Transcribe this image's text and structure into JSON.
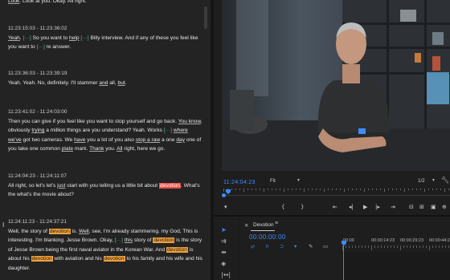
{
  "transcript": {
    "partial_top": [
      {
        "t": "Look",
        "u": true
      },
      {
        "t": ". Look at you. Okay. All right."
      }
    ],
    "paragraphs": [
      {
        "timestamp": "11:23:15:03 - 11:23:36:02",
        "segments": [
          {
            "t": "Yeah",
            "u": true
          },
          {
            "t": ". "
          },
          {
            "t": "[···]",
            "g": true
          },
          {
            "t": " So you want to "
          },
          {
            "t": "help",
            "u": true
          },
          {
            "t": " "
          },
          {
            "t": "[···]",
            "g": true
          },
          {
            "t": " Billy interview. And if any of these you feel like you want to "
          },
          {
            "t": "[···]",
            "g": true
          },
          {
            "t": " re answer."
          }
        ]
      },
      {
        "timestamp": "11:23:36:03 - 11:23:39:19",
        "segments": [
          {
            "t": "Yeah. Yeah. No, definitely. I'll stammer "
          },
          {
            "t": "and",
            "u": true
          },
          {
            "t": " all, "
          },
          {
            "t": "but",
            "u": true
          },
          {
            "t": "."
          }
        ]
      },
      {
        "timestamp": "11:23:41:02 - 11:24:03:00",
        "segments": [
          {
            "t": "Then you can give if you feel like you want to stop yourself and go back. "
          },
          {
            "t": "You know",
            "u": true
          },
          {
            "t": ", obviously "
          },
          {
            "t": "trying",
            "u": true
          },
          {
            "t": " a million things are you understand? Yeah. Works "
          },
          {
            "t": "[···]",
            "g": true
          },
          {
            "t": " "
          },
          {
            "t": "where we've",
            "u": true
          },
          {
            "t": " got two cameras. We "
          },
          {
            "t": "have",
            "u": true
          },
          {
            "t": " you a lot of you also "
          },
          {
            "t": "stop a raw",
            "u": true
          },
          {
            "t": " a one "
          },
          {
            "t": "day",
            "u": true
          },
          {
            "t": " one of you take one common "
          },
          {
            "t": "plate",
            "u": true
          },
          {
            "t": " mark. "
          },
          {
            "t": "Thank",
            "u": true
          },
          {
            "t": " you. "
          },
          {
            "t": "All",
            "u": true
          },
          {
            "t": " right, here we go."
          }
        ]
      },
      {
        "timestamp": "11:24:04:23 - 11:24:11:07",
        "segments": [
          {
            "t": "All right, so let's let's "
          },
          {
            "t": "just",
            "u": true
          },
          {
            "t": " start with you telling us a little bit about "
          },
          {
            "t": "devotion",
            "hs": true
          },
          {
            "t": ". What's the what's the movie about?"
          }
        ]
      },
      {
        "timestamp": "11:24:11:23 - 11:24:37:21",
        "segments": [
          {
            "t": "Well, the story of "
          },
          {
            "t": "devotion",
            "h": true
          },
          {
            "t": " is. "
          },
          {
            "t": "Well",
            "u": true
          },
          {
            "t": ", see, I'm already stammering. my God, This is interesting. I'm blanking. Jesse Brown. Okay, "
          },
          {
            "t": "[···]",
            "g": true
          },
          {
            "t": " "
          },
          {
            "t": "this",
            "u": true
          },
          {
            "t": " story of "
          },
          {
            "t": "devotion",
            "h": true
          },
          {
            "t": " is the story of Jesse Brown being the first naval aviator in the Korean War. And "
          },
          {
            "t": "devotion",
            "h": true
          },
          {
            "t": " is about his "
          },
          {
            "t": "devotion",
            "h": true
          },
          {
            "t": " with aviation and his "
          },
          {
            "t": "devotion",
            "h": true
          },
          {
            "t": " to his family and his wife and his daughter."
          }
        ]
      }
    ]
  },
  "monitor": {
    "current_timecode": "11:24:04:23",
    "fit_label": "Fit",
    "resolution_label": "1/2"
  },
  "timeline": {
    "sequence_name": "Devotion",
    "timecode": "00:00:00:00",
    "ruler_labels": [
      "00:00",
      "00:00:14:23",
      "00:00:29:23",
      "00:00:44:22"
    ]
  },
  "colors": {
    "accent_blue": "#3c8cff",
    "highlight_orange": "#f0a03a",
    "highlight_selected": "#e8504c",
    "gap_green": "#5cbf8e"
  },
  "icons": {
    "transport": [
      "marker-icon",
      "mark-in-icon",
      "mark-out-icon",
      "go-to-in-icon",
      "step-back-icon",
      "play-icon",
      "step-forward-icon",
      "go-to-out-icon",
      "insert-icon",
      "overwrite-icon",
      "export-frame-icon",
      "button-editor-icon"
    ],
    "tools": [
      "selection-tool-icon",
      "track-select-icon",
      "ripple-edit-icon",
      "razor-tool-icon",
      "slip-tool-icon"
    ]
  }
}
